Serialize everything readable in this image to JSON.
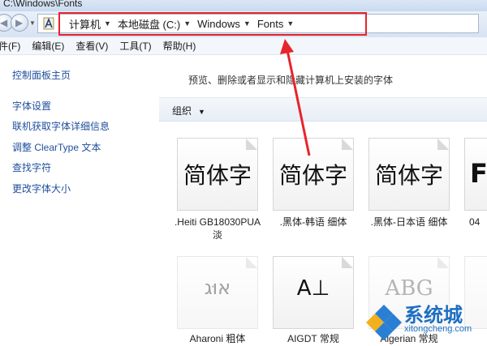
{
  "window": {
    "path": "C:\\Windows\\Fonts"
  },
  "address_bar": {
    "crumbs": [
      "计算机",
      "本地磁盘 (C:)",
      "Windows",
      "Fonts"
    ]
  },
  "menu": [
    "件(F)",
    "编辑(E)",
    "查看(V)",
    "工具(T)",
    "帮助(H)"
  ],
  "sidebar": {
    "home": "控制面板主页",
    "links": [
      "字体设置",
      "联机获取字体详细信息",
      "调整 ClearType 文本",
      "查找字符",
      "更改字体大小"
    ]
  },
  "main": {
    "description": "预览、删除或者显示和隐藏计算机上安装的字体",
    "organize": "组织"
  },
  "fonts": [
    {
      "sample": "简体字",
      "name": ".Heiti GB18030PUA 淡"
    },
    {
      "sample": "简体字",
      "name": ".黑体-韩语 细体"
    },
    {
      "sample": "简体字",
      "name": ".黑体-日本语 细体"
    },
    {
      "sample": "F",
      "name": "04"
    },
    {
      "sample": "אוּג",
      "name": "Aharoni 粗体"
    },
    {
      "sample": "A⊥",
      "name": "AIGDT 常规"
    },
    {
      "sample": "ABG",
      "name": "Algerian 常规"
    },
    {
      "sample": "",
      "name": ""
    }
  ],
  "watermark": {
    "text": "系统城",
    "url": "xitongcheng.com"
  },
  "colors": {
    "highlight": "#e8232a",
    "link": "#1f4e9c",
    "watermark": "#1d6fc1"
  },
  "icons": [
    "back-icon",
    "forward-icon",
    "fonts-folder-icon",
    "dropdown-icon",
    "system-city-logo-icon"
  ]
}
